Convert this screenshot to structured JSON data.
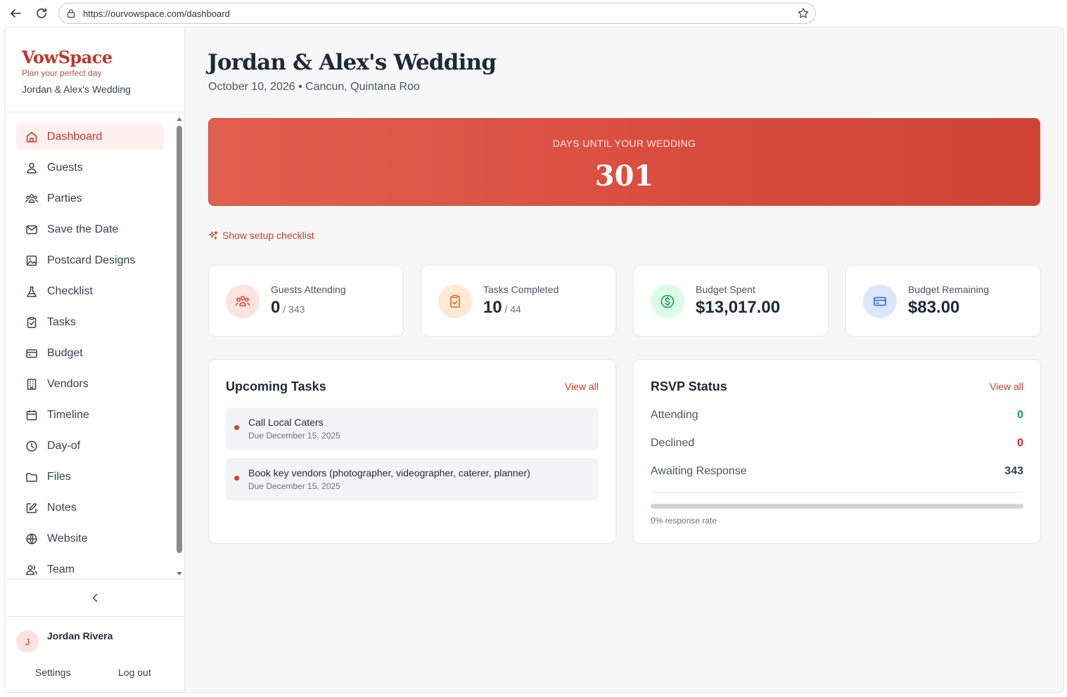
{
  "browser": {
    "url": "https://ourvowspace.com/dashboard"
  },
  "sidebar": {
    "brand": "VowSpace",
    "tagline": "Plan your perfect day",
    "wedding_name": "Jordan & Alex's Wedding",
    "items": [
      {
        "label": "Dashboard",
        "icon": "home-icon",
        "active": true
      },
      {
        "label": "Guests",
        "icon": "user-icon"
      },
      {
        "label": "Parties",
        "icon": "group-icon"
      },
      {
        "label": "Save the Date",
        "icon": "mail-icon"
      },
      {
        "label": "Postcard Designs",
        "icon": "image-icon"
      },
      {
        "label": "Checklist",
        "icon": "flask-icon"
      },
      {
        "label": "Tasks",
        "icon": "clipboard-check-icon"
      },
      {
        "label": "Budget",
        "icon": "wallet-icon"
      },
      {
        "label": "Vendors",
        "icon": "building-icon"
      },
      {
        "label": "Timeline",
        "icon": "calendar-icon"
      },
      {
        "label": "Day-of",
        "icon": "clock-icon"
      },
      {
        "label": "Files",
        "icon": "folder-icon"
      },
      {
        "label": "Notes",
        "icon": "edit-icon"
      },
      {
        "label": "Website",
        "icon": "globe-icon"
      },
      {
        "label": "Team",
        "icon": "users-icon"
      }
    ],
    "user": {
      "initial": "J",
      "name": "Jordan Rivera"
    },
    "settings_label": "Settings",
    "logout_label": "Log out"
  },
  "main": {
    "title": "Jordan & Alex's Wedding",
    "subtitle": "October 10, 2026 • Cancun, Quintana Roo",
    "countdown": {
      "label": "DAYS UNTIL YOUR WEDDING",
      "value": "301"
    },
    "setup_link": "Show setup checklist",
    "stats": [
      {
        "label": "Guests Attending",
        "value": "0",
        "of": " / 343",
        "icon": "group-icon",
        "bg": "#fde4e1",
        "color": "#d9493a"
      },
      {
        "label": "Tasks Completed",
        "value": "10",
        "of": " / 44",
        "icon": "clipboard-check-icon",
        "bg": "#fde9d6",
        "color": "#e06a1c"
      },
      {
        "label": "Budget Spent",
        "value": "$13,017.00",
        "of": "",
        "icon": "dollar-circle-icon",
        "bg": "#dcfce7",
        "color": "#16a34a"
      },
      {
        "label": "Budget Remaining",
        "value": "$83.00",
        "of": "",
        "icon": "credit-card-icon",
        "bg": "#dbe7fd",
        "color": "#2563eb"
      }
    ],
    "tasks_panel": {
      "title": "Upcoming Tasks",
      "view_all": "View all",
      "tasks": [
        {
          "title": "Call Local Caters",
          "due": "Due December 15, 2025"
        },
        {
          "title": "Book key vendors (photographer, videographer, caterer, planner)",
          "due": "Due December 15, 2025"
        }
      ]
    },
    "rsvp_panel": {
      "title": "RSVP Status",
      "view_all": "View all",
      "rows": [
        {
          "label": "Attending",
          "value": "0",
          "color": "#16a34a"
        },
        {
          "label": "Declined",
          "value": "0",
          "color": "#dc2626"
        },
        {
          "label": "Awaiting Response",
          "value": "343",
          "color": "#374151"
        }
      ],
      "response_rate": 0,
      "response_rate_label": "0% response rate"
    }
  }
}
